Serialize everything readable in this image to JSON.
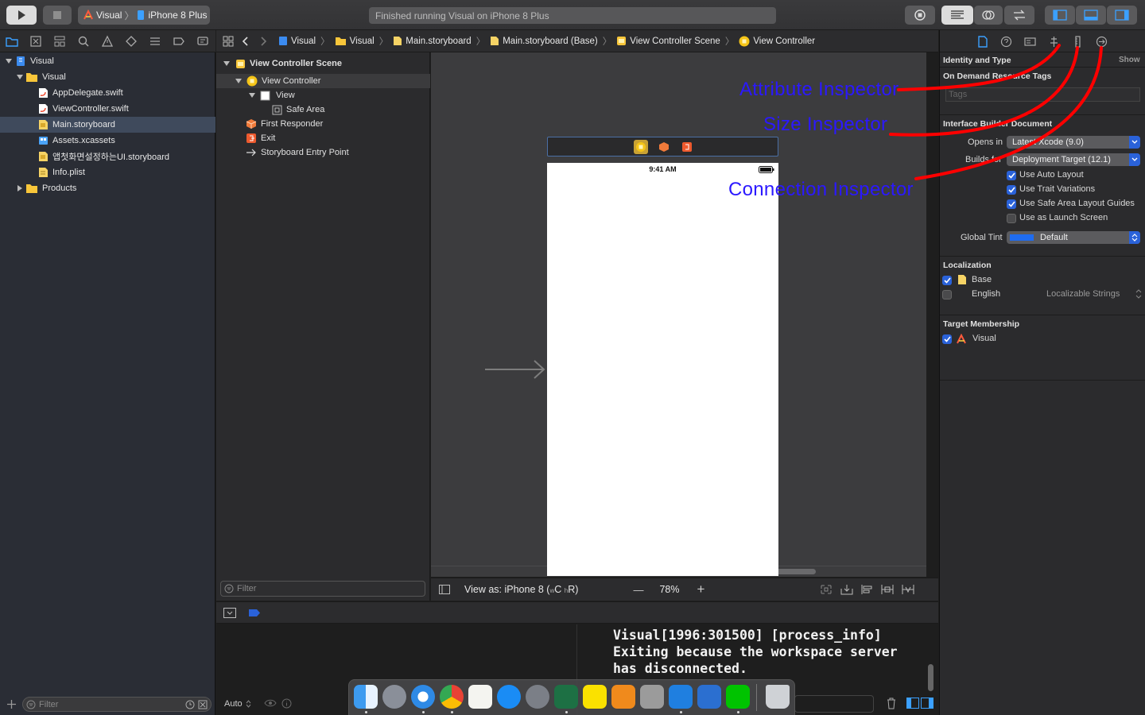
{
  "toolbar": {
    "scheme_target": "Visual",
    "scheme_device": "iPhone 8 Plus",
    "status_text": "Finished running Visual on iPhone 8 Plus"
  },
  "navigator": {
    "items": [
      {
        "label": "Visual",
        "icon": "project-icon"
      },
      {
        "label": "Visual",
        "icon": "folder-icon"
      },
      {
        "label": "AppDelegate.swift",
        "icon": "swift-file-icon"
      },
      {
        "label": "ViewController.swift",
        "icon": "swift-file-icon"
      },
      {
        "label": "Main.storyboard",
        "icon": "storyboard-icon"
      },
      {
        "label": "Assets.xcassets",
        "icon": "assets-icon"
      },
      {
        "label": "앱첫화면설정하는UI.storyboard",
        "icon": "storyboard-icon"
      },
      {
        "label": "Info.plist",
        "icon": "plist-icon"
      },
      {
        "label": "Products",
        "icon": "folder-icon"
      }
    ],
    "filter_placeholder": "Filter"
  },
  "jumpbar": {
    "crumbs": [
      "Visual",
      "Visual",
      "Main.storyboard",
      "Main.storyboard (Base)",
      "View Controller Scene",
      "View Controller"
    ]
  },
  "outline": {
    "items": [
      {
        "label": "View Controller Scene"
      },
      {
        "label": "View Controller"
      },
      {
        "label": "View"
      },
      {
        "label": "Safe Area"
      },
      {
        "label": "First Responder"
      },
      {
        "label": "Exit"
      },
      {
        "label": "Storyboard Entry Point"
      }
    ],
    "filter_placeholder": "Filter"
  },
  "canvas": {
    "device_time": "9:41 AM",
    "view_as_prefix": "View as: iPhone 8 (",
    "view_as_w": "w",
    "view_as_c": "C",
    "view_as_h": "h",
    "view_as_r": "R)",
    "zoom": "78%",
    "zoom_out": "—",
    "zoom_in": "+"
  },
  "inspector": {
    "identity_title": "Identity and Type",
    "show_label": "Show",
    "on_demand_title": "On Demand Resource Tags",
    "tags_placeholder": "Tags",
    "ib_document_title": "Interface Builder Document",
    "opens_in_label": "Opens in",
    "opens_in_value": "Latest Xcode (9.0)",
    "builds_for_label": "Builds for",
    "builds_for_value": "Deployment Target (12.1)",
    "checkboxes": [
      {
        "label": "Use Auto Layout",
        "checked": true
      },
      {
        "label": "Use Trait Variations",
        "checked": true
      },
      {
        "label": "Use Safe Area Layout Guides",
        "checked": true
      },
      {
        "label": "Use as Launch Screen",
        "checked": false
      }
    ],
    "global_tint_label": "Global Tint",
    "global_tint_value": "Default",
    "tint_color": "#1f6cf0",
    "localization_title": "Localization",
    "localizations": [
      {
        "label": "Base",
        "checked": true,
        "extra": ""
      },
      {
        "label": "English",
        "checked": false,
        "extra": "Localizable Strings"
      }
    ],
    "target_membership_title": "Target Membership",
    "targets": [
      {
        "label": "Visual",
        "checked": true
      }
    ]
  },
  "annotations": {
    "attribute": "Attribute Inspector",
    "size": "Size Inspector",
    "connection": "Connection Inspector",
    "color": "#2b18ff",
    "stroke_color": "#ff0000"
  },
  "debug": {
    "auto_label": "Auto",
    "console_lines": "Visual[1996:301500] [process_info]\nExiting because the workspace server\nhas disconnected."
  },
  "dock": {
    "apps": [
      "finder-icon",
      "launchpad-icon",
      "safari-icon",
      "chrome-icon",
      "textedit-icon",
      "app-store-icon",
      "system-preferences-icon",
      "excel-icon",
      "kakaotalk-icon",
      "ibooks-icon",
      "calculator-icon",
      "xcode-icon",
      "xcode-beta-icon",
      "line-icon",
      "trash-icon"
    ]
  }
}
